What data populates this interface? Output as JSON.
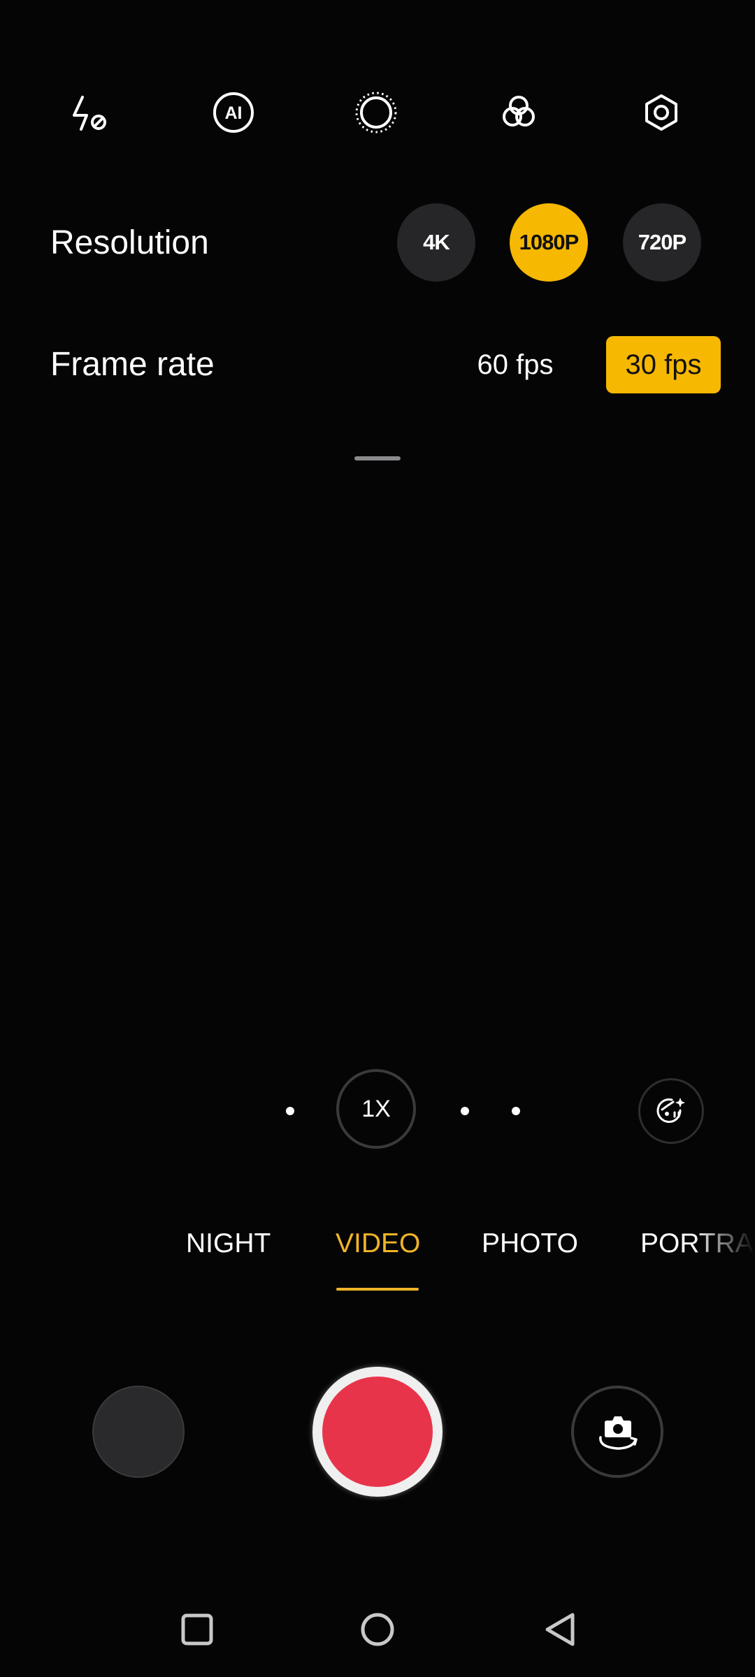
{
  "toolbar": {
    "icons": [
      "flash-off-icon",
      "ai-icon",
      "aperture-icon",
      "filters-icon",
      "settings-hexagon-icon"
    ],
    "ai_label": "AI"
  },
  "resolution": {
    "label": "Resolution",
    "options": [
      "4K",
      "1080P",
      "720P"
    ],
    "selected": "1080P"
  },
  "frame_rate": {
    "label": "Frame rate",
    "options": [
      "60 fps",
      "30 fps"
    ],
    "selected": "30 fps"
  },
  "zoom": {
    "label": "1X"
  },
  "modes": {
    "items": [
      "NIGHT",
      "VIDEO",
      "PHOTO",
      "PORTRA"
    ],
    "selected": "VIDEO"
  },
  "colors": {
    "accent": "#f6b800",
    "mode_active": "#f0b429",
    "record": "#e8344a",
    "background": "#050506"
  },
  "nav": {
    "icons": [
      "recents-square-icon",
      "home-circle-icon",
      "back-triangle-icon"
    ]
  }
}
